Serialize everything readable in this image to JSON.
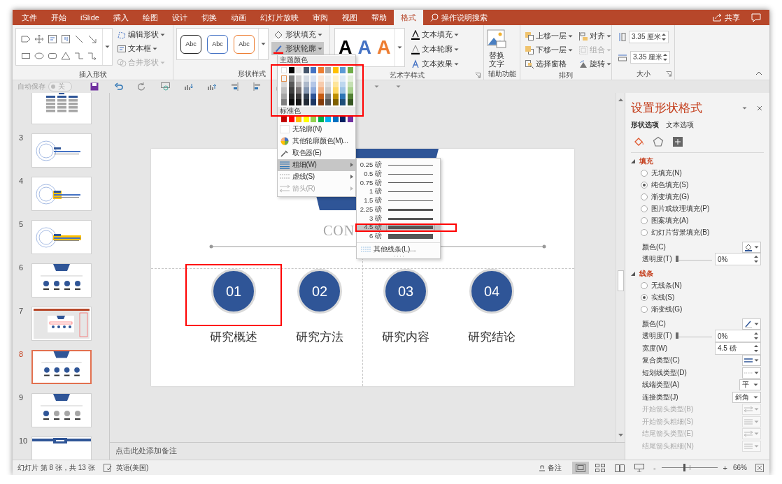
{
  "tabs": [
    {
      "label": "文件",
      "selected": false
    },
    {
      "label": "开始",
      "selected": false
    },
    {
      "label": "iSlide",
      "selected": false
    },
    {
      "label": "插入",
      "selected": false
    },
    {
      "label": "绘图",
      "selected": false
    },
    {
      "label": "设计",
      "selected": false
    },
    {
      "label": "切换",
      "selected": false
    },
    {
      "label": "动画",
      "selected": false
    },
    {
      "label": "幻灯片放映",
      "selected": false
    },
    {
      "label": "审阅",
      "selected": false
    },
    {
      "label": "视图",
      "selected": false
    },
    {
      "label": "帮助",
      "selected": false
    },
    {
      "label": "格式",
      "selected": true
    }
  ],
  "tell_me": {
    "placeholder": "操作说明搜索"
  },
  "share": "共享",
  "ribbon": {
    "insert_shapes": {
      "title": "插入形状",
      "commands": [
        {
          "label": "编辑形状",
          "kind": "edit_shape",
          "disabled": false
        },
        {
          "label": "文本框",
          "kind": "text_box",
          "disabled": false
        },
        {
          "label": "合并形状",
          "kind": "merge_shapes",
          "disabled": true
        }
      ]
    },
    "shape_styles": {
      "title": "形状样式",
      "presets": [
        {
          "label": "Abc",
          "color": "#262626"
        },
        {
          "label": "Abc",
          "color": "#4472c4"
        },
        {
          "label": "Abc",
          "color": "#ed7d31"
        }
      ],
      "commands": [
        {
          "label": "形状填充",
          "kind": "fill",
          "selected": false
        },
        {
          "label": "形状轮廓",
          "kind": "outline",
          "selected": true
        }
      ]
    },
    "wordart_styles": {
      "title": "艺术字样式",
      "presets": [
        {
          "label": "A",
          "color": "#000000",
          "kind": "solid"
        },
        {
          "label": "A",
          "color": "#4472c4",
          "kind": "solid"
        },
        {
          "label": "A",
          "color": "#ed7d31",
          "kind": "outline"
        }
      ],
      "commands": [
        {
          "label": "文本填充",
          "kind": "fill"
        },
        {
          "label": "文本轮廓",
          "kind": "outline"
        },
        {
          "label": "文本效果",
          "kind": "effects"
        }
      ]
    },
    "accessibility": {
      "title": "辅助功能",
      "button": [
        "替换",
        "文字"
      ]
    },
    "arrange": {
      "title": "排列",
      "commands": [
        {
          "label": "上移一层",
          "kind": "forward",
          "disabled": false
        },
        {
          "label": "对齐",
          "kind": "align",
          "disabled": false
        },
        {
          "label": "下移一层",
          "kind": "backward",
          "disabled": false
        },
        {
          "label": "组合",
          "kind": "group",
          "disabled": true
        },
        {
          "label": "选择窗格",
          "kind": "pane",
          "disabled": false
        },
        {
          "label": "旋转",
          "kind": "rotate",
          "disabled": false
        }
      ]
    },
    "size": {
      "title": "大小",
      "fields": [
        {
          "value": "3.35 厘米",
          "kind": "height"
        },
        {
          "value": "3.35 厘米",
          "kind": "width"
        }
      ]
    }
  },
  "quick_access": {
    "autosave": "自动保存",
    "toggle": {
      "label": "关",
      "on": false
    }
  },
  "slides": [
    {
      "kind": "org",
      "selected": false
    },
    {
      "number": "3",
      "kind": "rings",
      "selected": false
    },
    {
      "number": "4",
      "kind": "rings_highlight",
      "selected": false
    },
    {
      "number": "5",
      "kind": "rings_bar",
      "selected": false
    },
    {
      "number": "6",
      "kind": "agenda",
      "selected": false
    },
    {
      "number": "7",
      "kind": "screenshot",
      "selected": false
    },
    {
      "number": "8",
      "kind": "agenda",
      "selected": true
    },
    {
      "number": "9",
      "kind": "agenda_progress",
      "selected": false
    },
    {
      "number": "10",
      "kind": "title_bar",
      "selected": false
    }
  ],
  "slide": {
    "heading": "CON",
    "items": [
      {
        "number": "01",
        "label": "研究概述",
        "highlighted": true
      },
      {
        "number": "02",
        "label": "研究方法",
        "highlighted": false
      },
      {
        "number": "03",
        "label": "研究内容",
        "highlighted": false
      },
      {
        "number": "04",
        "label": "研究结论",
        "highlighted": false
      }
    ]
  },
  "notes": {
    "placeholder": "点击此处添加备注"
  },
  "outline_menu": {
    "theme_title": "主题颜色",
    "highlighted": true,
    "theme_rows": [
      [
        {
          "color": "#ffffff",
          "selected": false
        },
        {
          "color": "#000000",
          "selected": false
        },
        {
          "color": "#e7e6e6",
          "selected": false
        },
        {
          "color": "#44546a",
          "selected": false
        },
        {
          "color": "#4472c4",
          "selected": false
        },
        {
          "color": "#ed7d31",
          "selected": false
        },
        {
          "color": "#a5a5a5",
          "selected": false
        },
        {
          "color": "#ffc000",
          "selected": false
        },
        {
          "color": "#5b9bd5",
          "selected": false
        },
        {
          "color": "#70ad47",
          "selected": false
        }
      ],
      [
        {
          "color": "#f2f2f2",
          "selected": true
        },
        {
          "color": "#7f7f7f",
          "selected": false
        },
        {
          "color": "#d0cece",
          "selected": false
        },
        {
          "color": "#d6dce4",
          "selected": false
        },
        {
          "color": "#d9e2f3",
          "selected": false
        },
        {
          "color": "#fbe5d5",
          "selected": false
        },
        {
          "color": "#ededed",
          "selected": false
        },
        {
          "color": "#fff2cc",
          "selected": false
        },
        {
          "color": "#deebf6",
          "selected": false
        },
        {
          "color": "#e2efd9",
          "selected": false
        }
      ],
      [
        {
          "color": "#d8d8d8",
          "selected": false
        },
        {
          "color": "#595959",
          "selected": false
        },
        {
          "color": "#aeabab",
          "selected": false
        },
        {
          "color": "#adb9ca",
          "selected": false
        },
        {
          "color": "#b4c6e7",
          "selected": false
        },
        {
          "color": "#f7cbac",
          "selected": false
        },
        {
          "color": "#dbdbdb",
          "selected": false
        },
        {
          "color": "#fee599",
          "selected": false
        },
        {
          "color": "#bdd7ee",
          "selected": false
        },
        {
          "color": "#c5e0b3",
          "selected": false
        }
      ],
      [
        {
          "color": "#bfbfbf",
          "selected": false
        },
        {
          "color": "#3f3f3f",
          "selected": false
        },
        {
          "color": "#757070",
          "selected": false
        },
        {
          "color": "#8496b0",
          "selected": false
        },
        {
          "color": "#8eaadb",
          "selected": false
        },
        {
          "color": "#f4b183",
          "selected": false
        },
        {
          "color": "#c9c9c9",
          "selected": false
        },
        {
          "color": "#ffd965",
          "selected": false
        },
        {
          "color": "#9cc3e5",
          "selected": false
        },
        {
          "color": "#a8d08d",
          "selected": false
        }
      ],
      [
        {
          "color": "#a5a5a5",
          "selected": false
        },
        {
          "color": "#262626",
          "selected": false
        },
        {
          "color": "#3a3838",
          "selected": false
        },
        {
          "color": "#323f4f",
          "selected": false
        },
        {
          "color": "#2f5496",
          "selected": false
        },
        {
          "color": "#c55a11",
          "selected": false
        },
        {
          "color": "#7b7b7b",
          "selected": false
        },
        {
          "color": "#bf9000",
          "selected": false
        },
        {
          "color": "#2e75b5",
          "selected": false
        },
        {
          "color": "#538135",
          "selected": false
        }
      ],
      [
        {
          "color": "#7f7f7f",
          "selected": false
        },
        {
          "color": "#0c0c0c",
          "selected": false
        },
        {
          "color": "#171616",
          "selected": false
        },
        {
          "color": "#222a35",
          "selected": false
        },
        {
          "color": "#1f3864",
          "selected": false
        },
        {
          "color": "#833c0b",
          "selected": false
        },
        {
          "color": "#525252",
          "selected": false
        },
        {
          "color": "#7f6000",
          "selected": false
        },
        {
          "color": "#1e4e79",
          "selected": false
        },
        {
          "color": "#375623",
          "selected": false
        }
      ]
    ],
    "standard_title": "标准色",
    "standard_colors": [
      {
        "color": "#c00000",
        "selected": false
      },
      {
        "color": "#ff0000",
        "selected": false
      },
      {
        "color": "#ffc000",
        "selected": false
      },
      {
        "color": "#ffff00",
        "selected": false
      },
      {
        "color": "#92d050",
        "selected": false
      },
      {
        "color": "#00b050",
        "selected": false
      },
      {
        "color": "#00b0f0",
        "selected": false
      },
      {
        "color": "#0070c0",
        "selected": false
      },
      {
        "color": "#002060",
        "selected": false
      },
      {
        "color": "#7030a0",
        "selected": false
      }
    ],
    "items": [
      {
        "label": "无轮廓(N)",
        "kind": "none",
        "disabled": false,
        "selected": false,
        "submenu": false
      },
      {
        "label": "其他轮廓颜色(M)...",
        "kind": "more_colors",
        "disabled": false,
        "selected": false,
        "submenu": false
      },
      {
        "label": "取色器(E)",
        "kind": "eyedropper",
        "disabled": false,
        "selected": false,
        "submenu": false
      },
      {
        "label": "粗细(W)",
        "kind": "weight",
        "disabled": false,
        "selected": true,
        "submenu": true
      },
      {
        "label": "虚线(S)",
        "kind": "dash",
        "disabled": false,
        "selected": false,
        "submenu": true
      },
      {
        "label": "箭头(R)",
        "kind": "arrows",
        "disabled": true,
        "selected": false,
        "submenu": true
      }
    ]
  },
  "weight_menu": {
    "items": [
      {
        "label": "0.25 磅",
        "selected": false,
        "highlighted": false
      },
      {
        "label": "0.5 磅",
        "selected": false,
        "highlighted": false
      },
      {
        "label": "0.75 磅",
        "selected": false,
        "highlighted": false
      },
      {
        "label": "1 磅",
        "selected": false,
        "highlighted": false
      },
      {
        "label": "1.5 磅",
        "selected": false,
        "highlighted": false
      },
      {
        "label": "2.25 磅",
        "selected": false,
        "highlighted": false
      },
      {
        "label": "3 磅",
        "selected": false,
        "highlighted": false
      },
      {
        "label": "4.5 磅",
        "selected": true,
        "highlighted": true
      },
      {
        "label": "6 磅",
        "selected": false,
        "highlighted": false
      }
    ],
    "more": "其他线条(L)..."
  },
  "format_pane": {
    "title": "设置形状格式",
    "tabs": [
      {
        "label": "形状选项",
        "selected": true
      },
      {
        "label": "文本选项",
        "selected": false
      }
    ],
    "icon_tabs": [
      {
        "kind": "fill_line",
        "selected": true
      },
      {
        "kind": "effects",
        "selected": false
      },
      {
        "kind": "size",
        "selected": false
      }
    ],
    "sections": [
      {
        "title": "填充",
        "expanded": true,
        "options": [
          {
            "label": "无填充(N)",
            "selected": false
          },
          {
            "label": "纯色填充(S)",
            "selected": true
          },
          {
            "label": "渐变填充(G)",
            "selected": false
          },
          {
            "label": "图片或纹理填充(P)",
            "selected": false
          },
          {
            "label": "图案填充(A)",
            "selected": false
          },
          {
            "label": "幻灯片背景填充(B)",
            "selected": false
          }
        ],
        "properties": [
          {
            "label": "颜色(C)",
            "kind": "fill_color",
            "disabled": false
          },
          {
            "label": "透明度(T)",
            "kind": "slider",
            "value": "0%",
            "level": 0,
            "disabled": false
          }
        ]
      },
      {
        "title": "线条",
        "expanded": true,
        "options": [
          {
            "label": "无线条(N)",
            "selected": false
          },
          {
            "label": "实线(S)",
            "selected": true
          },
          {
            "label": "渐变线(G)",
            "selected": false
          }
        ],
        "properties": [
          {
            "label": "颜色(C)",
            "kind": "line_color",
            "disabled": false
          },
          {
            "label": "透明度(T)",
            "kind": "slider",
            "value": "0%",
            "level": 0,
            "disabled": false
          },
          {
            "label": "宽度(W)",
            "kind": "spin",
            "value": "4.5 磅",
            "disabled": false
          },
          {
            "label": "复合类型(C)",
            "kind": "compound",
            "disabled": false
          },
          {
            "label": "短划线类型(D)",
            "kind": "dash",
            "disabled": false
          },
          {
            "label": "线端类型(A)",
            "kind": "select",
            "value": "平",
            "disabled": false
          },
          {
            "label": "连接类型(J)",
            "kind": "select",
            "value": "斜角",
            "disabled": false
          },
          {
            "label": "开始箭头类型(B)",
            "kind": "arrow_type",
            "disabled": true
          },
          {
            "label": "开始箭头粗细(S)",
            "kind": "arrow_size",
            "disabled": true
          },
          {
            "label": "结尾箭头类型(E)",
            "kind": "arrow_type",
            "disabled": true
          },
          {
            "label": "结尾箭头粗细(N)",
            "kind": "arrow_size",
            "disabled": true
          }
        ]
      }
    ]
  },
  "status_bar": {
    "slide_info": "幻灯片 第 8 张，共 13 张",
    "language": "英语(美国)",
    "notes": "备注",
    "views": [
      {
        "kind": "normal",
        "selected": true
      },
      {
        "kind": "sorter",
        "selected": false
      },
      {
        "kind": "reading",
        "selected": false
      },
      {
        "kind": "slideshow",
        "selected": false
      }
    ],
    "zoom": {
      "minus": "-",
      "plus": "+",
      "level": 0.41,
      "value": "66%"
    }
  }
}
